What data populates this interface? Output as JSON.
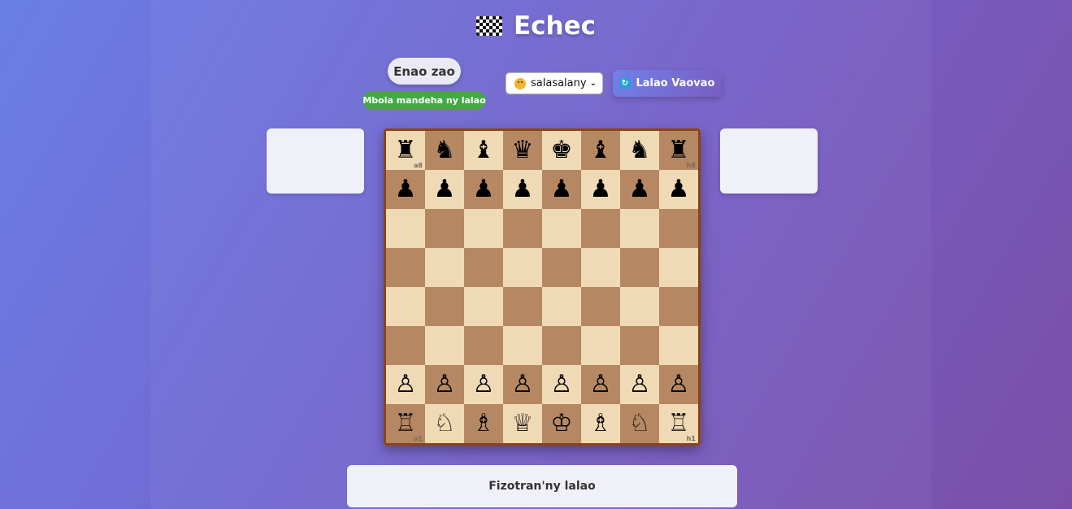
{
  "header": {
    "title": "Echec",
    "icon": "chequered-flag-icon"
  },
  "game": {
    "turn_label": "Enao zao",
    "status_text": "Mbola mandeha ny lalao",
    "status_color": "#43a947"
  },
  "controls": {
    "difficulty_selected": "salasalany",
    "difficulty_icon": "thinking-face-icon",
    "new_game_label": "Lalao Vaovao",
    "new_game_icon": "refresh-icon"
  },
  "board": {
    "light_color": "#f0d9b5",
    "dark_color": "#b58863",
    "ranks": [
      [
        "♜",
        "♞",
        "♝",
        "♛",
        "♚",
        "♝",
        "♞",
        "♜"
      ],
      [
        "♟",
        "♟",
        "♟",
        "♟",
        "♟",
        "♟",
        "♟",
        "♟"
      ],
      [
        "",
        "",
        "",
        "",
        "",
        "",
        "",
        ""
      ],
      [
        "",
        "",
        "",
        "",
        "",
        "",
        "",
        ""
      ],
      [
        "",
        "",
        "",
        "",
        "",
        "",
        "",
        ""
      ],
      [
        "",
        "",
        "",
        "",
        "",
        "",
        "",
        ""
      ],
      [
        "♙",
        "♙",
        "♙",
        "♙",
        "♙",
        "♙",
        "♙",
        "♙"
      ],
      [
        "♖",
        "♘",
        "♗",
        "♕",
        "♔",
        "♗",
        "♘",
        "♖"
      ]
    ],
    "coordinates": {
      "a8": "a8",
      "h8": "h8",
      "a1": "a1",
      "h1": "h1"
    }
  },
  "history": {
    "title": "Fizotran'ny lalao"
  }
}
